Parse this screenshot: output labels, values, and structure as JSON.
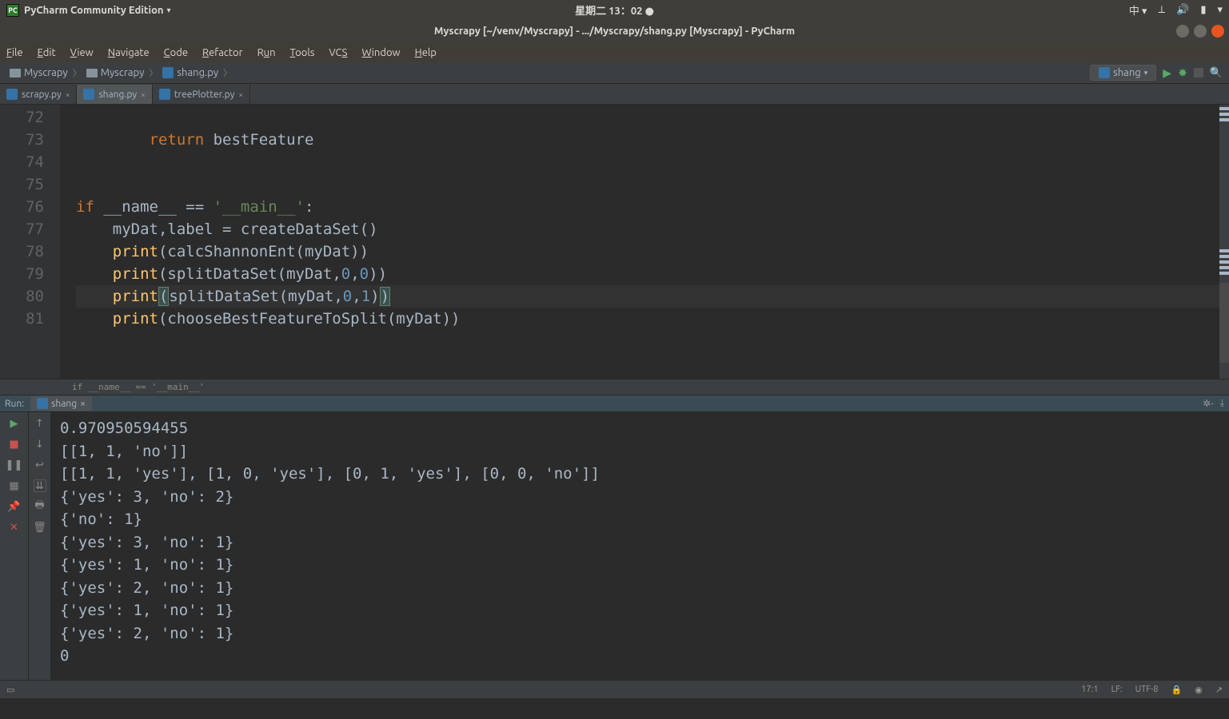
{
  "topbar": {
    "app_label": "PyCharm Community Edition",
    "center_text": "星期二 13：02",
    "input_method": "中"
  },
  "titlebar": {
    "text": "Myscrapy [~/venv/Myscrapy] - .../Myscrapy/shang.py [Myscrapy] - PyCharm"
  },
  "menu": {
    "items": [
      "File",
      "Edit",
      "View",
      "Navigate",
      "Code",
      "Refactor",
      "Run",
      "Tools",
      "VCS",
      "Window",
      "Help"
    ]
  },
  "breadcrumbs": {
    "items": [
      "Myscrapy",
      "Myscrapy",
      "shang.py"
    ]
  },
  "run_config": {
    "selected": "shang"
  },
  "tabs": {
    "items": [
      {
        "name": "scrapy.py",
        "active": false
      },
      {
        "name": "shang.py",
        "active": true
      },
      {
        "name": "treePlotter.py",
        "active": false
      }
    ]
  },
  "editor": {
    "lines": [
      {
        "num": "72",
        "html": ""
      },
      {
        "num": "73",
        "html": "        <span class='k'>return </span>bestFeature"
      },
      {
        "num": "74",
        "html": ""
      },
      {
        "num": "75",
        "html": ""
      },
      {
        "num": "76",
        "html": "<span class='k'>if</span> __name__ == <span class='s'>'__main__'</span>:",
        "runnable": true,
        "fold": true
      },
      {
        "num": "77",
        "html": "    myDat<span class='p'>,</span>label = createDataSet()"
      },
      {
        "num": "78",
        "html": "    <span class='fn'>print</span>(calcShannonEnt(myDat))"
      },
      {
        "num": "79",
        "html": "    <span class='fn'>print</span>(splitDataSet(myDat<span class='p'>,</span><span class='n'>0</span><span class='p'>,</span><span class='n'>0</span>))"
      },
      {
        "num": "80",
        "html": "    <span class='fn'>print</span><span class='paren-match'>(</span>splitDataSet(myDat<span class='p'>,</span><span class='n'>0</span><span class='p'>,</span><span class='n'>1</span>)<span class='paren-match'>)</span>",
        "current": true
      },
      {
        "num": "81",
        "html": "    <span class='fn'>print</span>(chooseBestFeatureToSplit(myDat))",
        "fold_end": true
      }
    ],
    "crumb": "if __name__ == '__main__'"
  },
  "run_panel": {
    "label": "Run:",
    "tab_name": "shang"
  },
  "output_lines": [
    "0.970950594455",
    "[[1, 1, 'no']]",
    "[[1, 1, 'yes'], [1, 0, 'yes'], [0, 1, 'yes'], [0, 0, 'no']]",
    "{'yes': 3, 'no': 2}",
    "{'no': 1}",
    "{'yes': 3, 'no': 1}",
    "{'yes': 1, 'no': 1}",
    "{'yes': 2, 'no': 1}",
    "{'yes': 1, 'no': 1}",
    "{'yes': 2, 'no': 1}",
    "0"
  ],
  "status": {
    "pos": "17:1",
    "sep": "LF:",
    "enc": "UTF-8"
  }
}
